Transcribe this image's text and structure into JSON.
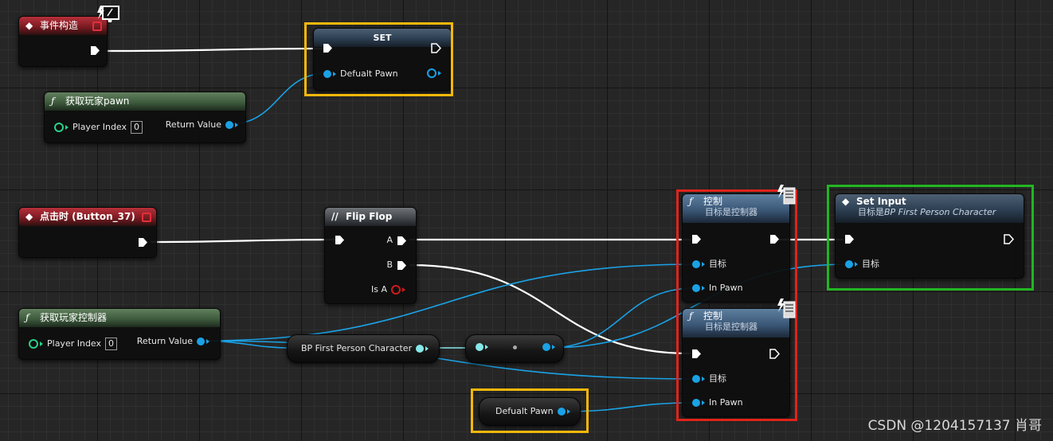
{
  "nodes": {
    "event_construct": {
      "title": "事件构造"
    },
    "get_player_pawn": {
      "title": "获取玩家pawn",
      "player_index_label": "Player Index",
      "player_index_value": "0",
      "return_label": "Return Value"
    },
    "set_node": {
      "title": "SET",
      "var_label": "Defualt Pawn"
    },
    "on_clicked": {
      "title": "点击时 (Button_37)"
    },
    "flip_flop": {
      "title": "Flip Flop",
      "a_label": "A",
      "b_label": "B",
      "is_a_label": "Is A"
    },
    "get_player_controller": {
      "title": "获取玩家控制器",
      "player_index_label": "Player Index",
      "player_index_value": "0",
      "return_label": "Return Value"
    },
    "bp_cast": {
      "label": "BP First Person Character"
    },
    "possess_1": {
      "title": "控制",
      "subtitle": "目标是控制器",
      "target_label": "目标",
      "in_pawn_label": "In Pawn"
    },
    "possess_2": {
      "title": "控制",
      "subtitle": "目标是控制器",
      "target_label": "目标",
      "in_pawn_label": "In Pawn"
    },
    "set_input": {
      "title": "Set Input",
      "subtitle_prefix": "目标是",
      "subtitle_class": "BP First Person Character",
      "target_label": "目标"
    },
    "default_pawn_getter": {
      "label": "Defualt Pawn"
    }
  },
  "icons": {
    "event": "diamond-event-icon",
    "function": "function-f-icon",
    "flipflop": "flipflop-icon",
    "exec": "exec-arrow-icon"
  },
  "colors": {
    "object_pin": "#1aa2e6",
    "class_pin": "#86e8e8",
    "int_pin": "#27d18a",
    "bool_pin": "#d01a1a",
    "exec_wire": "#ffffff",
    "highlight_orange": "#f5b80a",
    "highlight_red": "#e0231a",
    "highlight_green": "#23b523"
  },
  "watermark": "CSDN @1204157137 肖哥"
}
